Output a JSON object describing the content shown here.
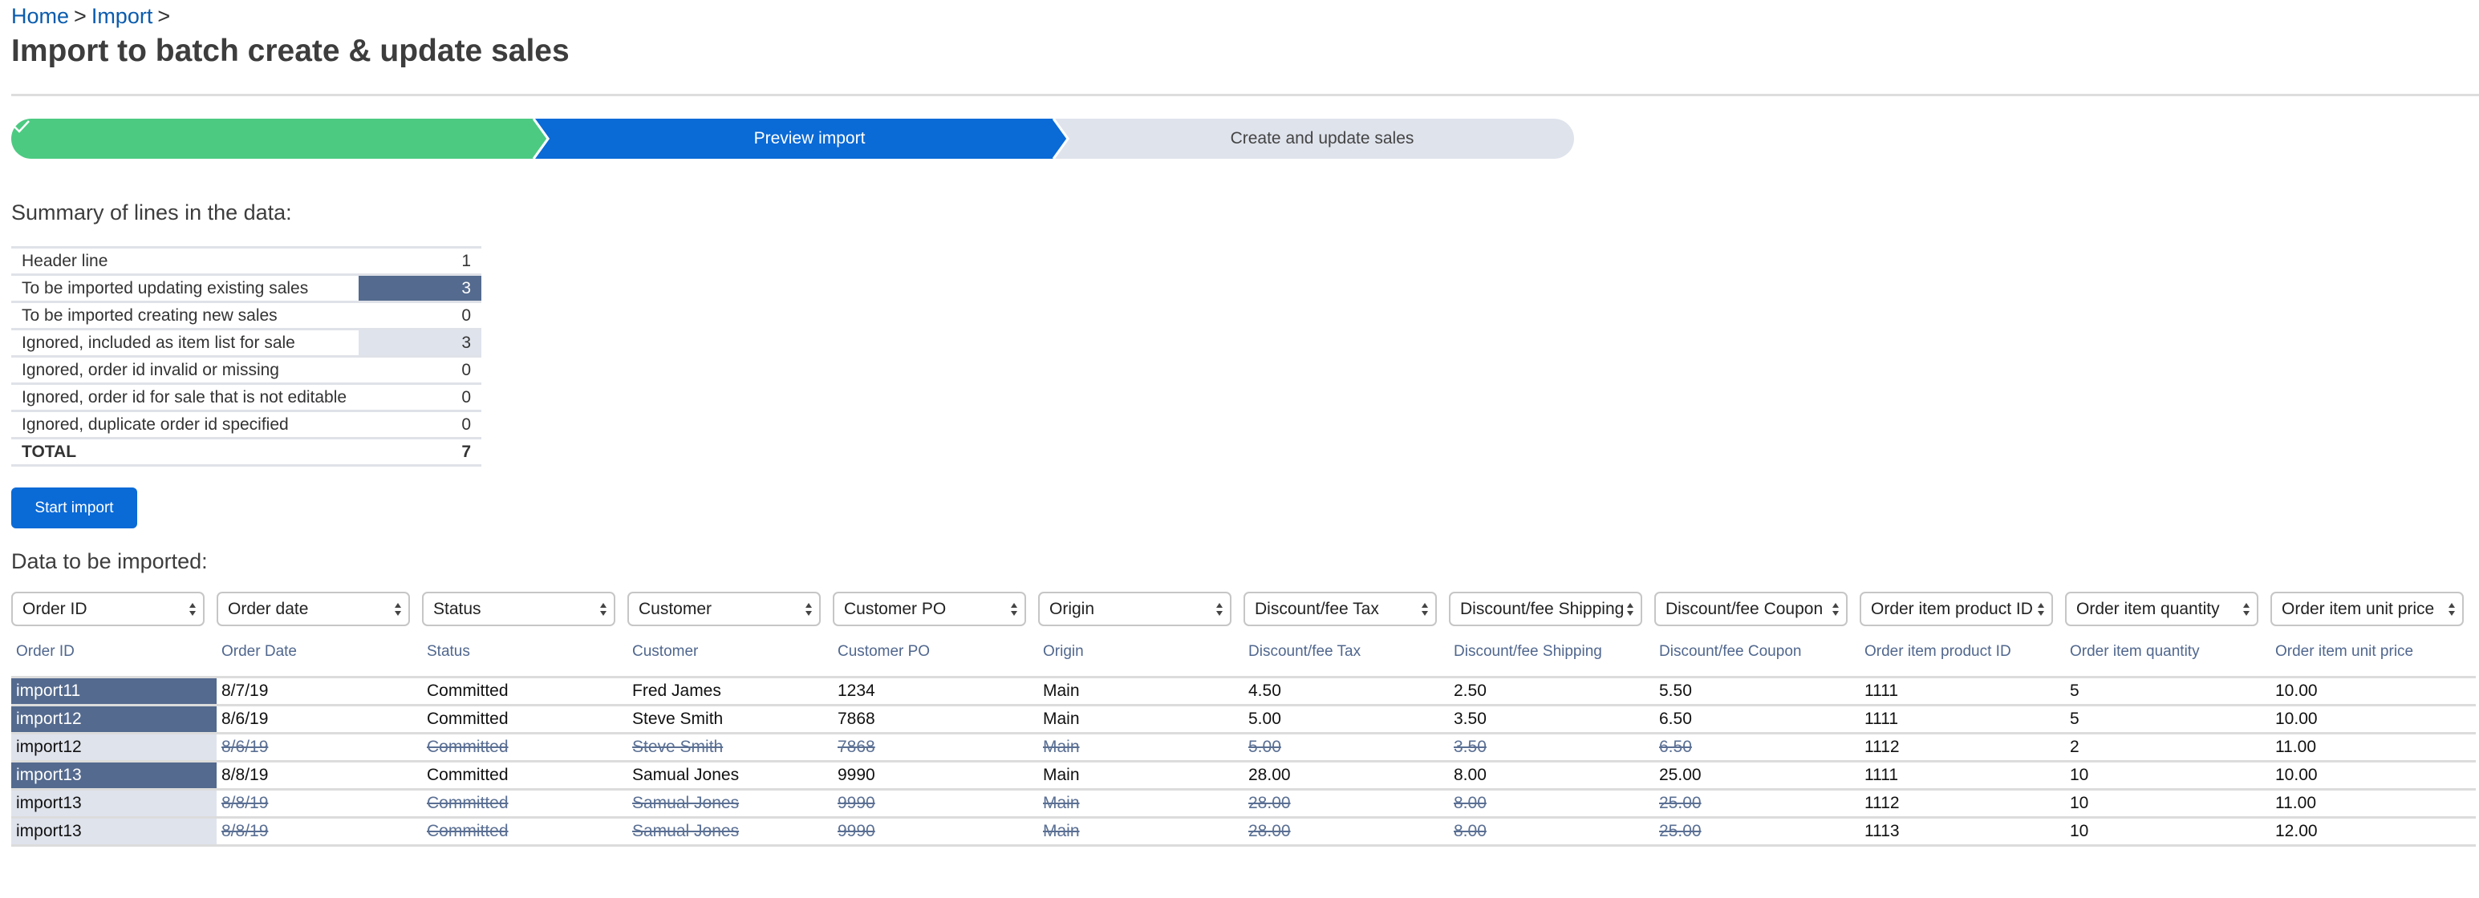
{
  "breadcrumb": {
    "items": [
      {
        "label": "Home"
      },
      {
        "label": "Import"
      }
    ],
    "separator": ">"
  },
  "page_title": "Import to batch create & update sales",
  "steps": [
    {
      "label": "",
      "state": "done",
      "icon": "check-icon",
      "color": "#4cca82"
    },
    {
      "label": "Preview import",
      "state": "active",
      "color": "#0a6ad6"
    },
    {
      "label": "Create and update sales",
      "state": "pending",
      "color": "#dfe3ec"
    }
  ],
  "summary": {
    "heading": "Summary of lines in the data:",
    "rows": [
      {
        "label": "Header line",
        "value": "1",
        "highlight": ""
      },
      {
        "label": "To be imported updating existing sales",
        "value": "3",
        "highlight": "dark"
      },
      {
        "label": "To be imported creating new sales",
        "value": "0",
        "highlight": ""
      },
      {
        "label": "Ignored, included as item list for sale",
        "value": "3",
        "highlight": "light"
      },
      {
        "label": "Ignored, order id invalid or missing",
        "value": "0",
        "highlight": ""
      },
      {
        "label": "Ignored, order id for sale that is not editable",
        "value": "0",
        "highlight": ""
      },
      {
        "label": "Ignored, duplicate order id specified",
        "value": "0",
        "highlight": ""
      }
    ],
    "total": {
      "label": "TOTAL",
      "value": "7"
    }
  },
  "start_import_label": "Start import",
  "data_heading": "Data to be imported:",
  "columns": [
    {
      "mapping": "Order ID",
      "label": "Order ID"
    },
    {
      "mapping": "Order date",
      "label": "Order Date"
    },
    {
      "mapping": "Status",
      "label": "Status"
    },
    {
      "mapping": "Customer",
      "label": "Customer"
    },
    {
      "mapping": "Customer PO",
      "label": "Customer PO"
    },
    {
      "mapping": "Origin",
      "label": "Origin"
    },
    {
      "mapping": "Discount/fee Tax",
      "label": "Discount/fee Tax"
    },
    {
      "mapping": "Discount/fee Shipping",
      "label": "Discount/fee Shipping"
    },
    {
      "mapping": "Discount/fee Coupon",
      "label": "Discount/fee Coupon"
    },
    {
      "mapping": "Order item product ID",
      "label": "Order item product ID"
    },
    {
      "mapping": "Order item quantity",
      "label": "Order item quantity"
    },
    {
      "mapping": "Order item unit price",
      "label": "Order item unit price"
    }
  ],
  "rows": [
    {
      "type": "primary",
      "cells": [
        "import11",
        "8/7/19",
        "Committed",
        "Fred James",
        "1234",
        "Main",
        "4.50",
        "2.50",
        "5.50",
        "1111",
        "5",
        "10.00"
      ]
    },
    {
      "type": "primary",
      "cells": [
        "import12",
        "8/6/19",
        "Committed",
        "Steve Smith",
        "7868",
        "Main",
        "5.00",
        "3.50",
        "6.50",
        "1111",
        "5",
        "10.00"
      ]
    },
    {
      "type": "item",
      "cells": [
        "import12",
        "8/6/19",
        "Committed",
        "Steve Smith",
        "7868",
        "Main",
        "5.00",
        "3.50",
        "6.50",
        "1112",
        "2",
        "11.00"
      ]
    },
    {
      "type": "primary",
      "cells": [
        "import13",
        "8/8/19",
        "Committed",
        "Samual Jones",
        "9990",
        "Main",
        "28.00",
        "8.00",
        "25.00",
        "1111",
        "10",
        "10.00"
      ]
    },
    {
      "type": "item",
      "cells": [
        "import13",
        "8/8/19",
        "Committed",
        "Samual Jones",
        "9990",
        "Main",
        "28.00",
        "8.00",
        "25.00",
        "1112",
        "10",
        "11.00"
      ]
    },
    {
      "type": "item",
      "cells": [
        "import13",
        "8/8/19",
        "Committed",
        "Samual Jones",
        "9990",
        "Main",
        "28.00",
        "8.00",
        "25.00",
        "1113",
        "10",
        "12.00"
      ]
    }
  ],
  "struck_columns_for_item_rows": [
    1,
    2,
    3,
    4,
    5,
    6,
    7,
    8
  ]
}
